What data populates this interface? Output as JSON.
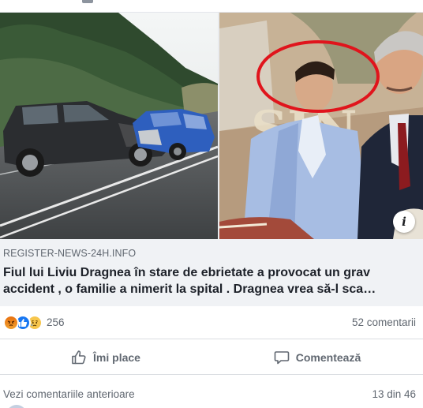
{
  "post": {
    "link": {
      "domain": "REGISTER-NEWS-24H.INFO",
      "headline": "Fiul lui Liviu Dragnea în stare de ebrietate a provocat un grav accident , o familie a nimerit la spital . Dragnea vrea să-l sca…",
      "info_icon": "i"
    },
    "reactions": {
      "icons": [
        "angry-icon",
        "like-icon",
        "sad-icon"
      ],
      "count": "256"
    },
    "comments_count": "52 comentarii",
    "actions": {
      "like_label": "Îmi place",
      "comment_label": "Comentează"
    },
    "comments": {
      "previous_label": "Vezi comentariile anterioare",
      "pagination": "13 din 46"
    }
  },
  "colors": {
    "accent": "#1877f2",
    "text_secondary": "#606770",
    "meta_background": "#f0f2f5",
    "highlight_circle": "#e0141c"
  }
}
